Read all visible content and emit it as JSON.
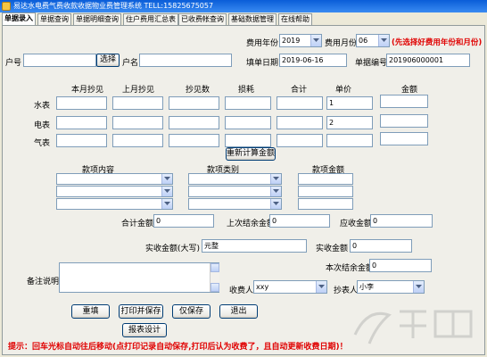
{
  "window": {
    "title": "易达水电费气费收款收据物业费管理系统 TELL:15825675057"
  },
  "tabs": [
    {
      "label": "单据录入"
    },
    {
      "label": "单据查询"
    },
    {
      "label": "单据明细查询"
    },
    {
      "label": "住户费用汇总表"
    },
    {
      "label": "已收费帐查询"
    },
    {
      "label": "基础数据管理"
    },
    {
      "label": "在线帮助"
    }
  ],
  "header": {
    "fee_year_label": "费用年份",
    "fee_year": "2019",
    "fee_month_label": "费用月份",
    "fee_month": "06",
    "year_month_hint": "(先选择好费用年份和月份)",
    "household_no_label": "户号",
    "household_no": "",
    "select_button": "选择",
    "household_name_label": "户名",
    "household_name": "",
    "fill_date_label": "填单日期",
    "fill_date": "2019-06-16",
    "doc_no_label": "单据编号",
    "doc_no": "201906000001"
  },
  "meter": {
    "columns": [
      "本月抄见",
      "上月抄见",
      "抄见数",
      "损耗",
      "合计",
      "单价",
      "金额"
    ],
    "rows": [
      {
        "label": "水表",
        "values": [
          "",
          "",
          "",
          "",
          "",
          "1",
          ""
        ]
      },
      {
        "label": "电表",
        "values": [
          "",
          "",
          "",
          "",
          "",
          "2",
          ""
        ]
      },
      {
        "label": "气表",
        "values": [
          "",
          "",
          "",
          "",
          "",
          "",
          ""
        ]
      }
    ],
    "recalc_button": "重新计算金额"
  },
  "items": {
    "columns": [
      "款项内容",
      "款项类别",
      "款项金额"
    ],
    "rows": [
      {
        "content": "",
        "category": "",
        "amount": ""
      },
      {
        "content": "",
        "category": "",
        "amount": ""
      },
      {
        "content": "",
        "category": "",
        "amount": ""
      }
    ]
  },
  "totals": {
    "total_label": "合计金额",
    "total": "0",
    "last_balance_label": "上次结余金额",
    "last_balance": "0",
    "receivable_label": "应收金额",
    "receivable": "0",
    "received_upper_label": "实收金额(大写)",
    "received_upper": "元整",
    "received_label": "实收金额",
    "received": "0",
    "current_balance_label": "本次结余金额",
    "current_balance": "0"
  },
  "remarks": {
    "label": "备注说明",
    "value": ""
  },
  "people": {
    "payee_label": "收费人",
    "payee": "xxy",
    "reader_label": "抄表人",
    "reader": "小李"
  },
  "buttons": {
    "refill": "重填",
    "print_save": "打印并保存",
    "save_only": "仅保存",
    "exit": "退出",
    "report_design": "报表设计"
  },
  "hint": "提示：回车光标自动往后移动(点打印记录自动保存,打印后认为收费了，且自动更新收费日期)！",
  "colors": {
    "titlebar": "#0A5DD8",
    "hint_red": "#E00000",
    "panel": "#F0EFE9"
  }
}
